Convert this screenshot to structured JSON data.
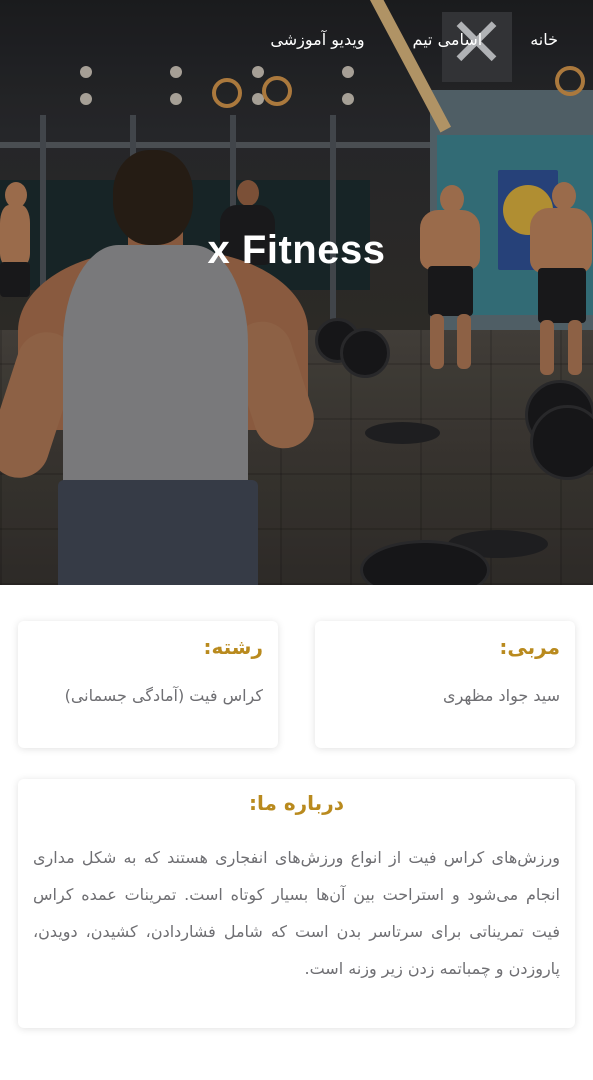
{
  "nav": {
    "items": [
      {
        "label": "خانه"
      },
      {
        "label": "اسامی تیم"
      },
      {
        "label": "ویدیو آموزشی"
      }
    ]
  },
  "hero": {
    "title": "x Fitness",
    "background_desc_colors": {
      "wall": "#2b2c2f",
      "accent_teal": "#27a3a6",
      "floor": "#3e3a35"
    }
  },
  "coach_card": {
    "title": "مربی:",
    "value": "سید جواد مظهری"
  },
  "field_card": {
    "title": "رشته:",
    "value": "کراس فیت (آمادگی جسمانی)"
  },
  "about_card": {
    "title": "درباره ما:",
    "text": "ورزش‌های کراس فیت از انواع ورزش‌های انفجاری هستند که به شکل مداری انجام می‌شود و استراحت بین آن‌ها بسیار کوتاه است. تمرینات عمده کراس فیت تمریناتی برای سرتاسر بدن است که شامل فشاردادن، کشیدن، دویدن، پاروزدن و چمباتمه زدن زیر وزنه است."
  },
  "colors": {
    "accent": "#b98a1e",
    "body_text": "#6f6f73",
    "background": "#ffffff"
  }
}
